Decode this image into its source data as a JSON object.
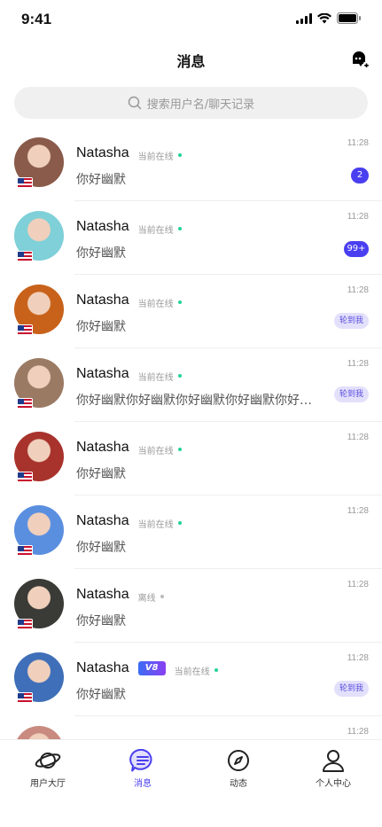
{
  "status_bar": {
    "time": "9:41"
  },
  "header": {
    "title": "消息",
    "action_icon": "chat-plus-icon"
  },
  "search": {
    "placeholder": "搜索用户名/聊天记录"
  },
  "conversations": [
    {
      "name": "Natasha",
      "status": "当前在线",
      "status_color": "#22d39b",
      "message": "你好幽默",
      "time": "11:28",
      "badge": "2",
      "tag": "",
      "vip": "",
      "avatar_color": "#8a5a4a",
      "flag": "us-flag-icon"
    },
    {
      "name": "Natasha",
      "status": "当前在线",
      "status_color": "#22d39b",
      "message": "你好幽默",
      "time": "11:28",
      "badge": "99+",
      "tag": "",
      "vip": "",
      "avatar_color": "#7fd0d8",
      "flag": "us-flag-icon"
    },
    {
      "name": "Natasha",
      "status": "当前在线",
      "status_color": "#22d39b",
      "message": "你好幽默",
      "time": "11:28",
      "badge": "",
      "tag": "轮到我",
      "vip": "",
      "avatar_color": "#c8621a",
      "flag": "us-flag-icon"
    },
    {
      "name": "Natasha",
      "status": "当前在线",
      "status_color": "#22d39b",
      "message": "你好幽默你好幽默你好幽默你好幽默你好幽默你好幽默",
      "time": "11:28",
      "badge": "",
      "tag": "轮到我",
      "vip": "",
      "avatar_color": "#9b7a64",
      "flag": "us-flag-icon"
    },
    {
      "name": "Natasha",
      "status": "当前在线",
      "status_color": "#22d39b",
      "message": "你好幽默",
      "time": "11:28",
      "badge": "",
      "tag": "",
      "vip": "",
      "avatar_color": "#a8332c",
      "flag": "us-flag-icon"
    },
    {
      "name": "Natasha",
      "status": "当前在线",
      "status_color": "#22d39b",
      "message": "你好幽默",
      "time": "11:28",
      "badge": "",
      "tag": "",
      "vip": "",
      "avatar_color": "#5a8fe0",
      "flag": "us-flag-icon"
    },
    {
      "name": "Natasha",
      "status": "离线",
      "status_color": "#bbbbbb",
      "message": "你好幽默",
      "time": "11:28",
      "badge": "",
      "tag": "",
      "vip": "",
      "avatar_color": "#3a3a36",
      "flag": "us-flag-icon"
    },
    {
      "name": "Natasha",
      "status": "当前在线",
      "status_color": "#22d39b",
      "message": "你好幽默",
      "time": "11:28",
      "badge": "",
      "tag": "轮到我",
      "vip": "V8",
      "avatar_color": "#3f6fb8",
      "flag": "us-flag-icon"
    },
    {
      "name": "",
      "status": "",
      "status_color": "#22d39b",
      "message": "",
      "time": "11:28",
      "badge": "",
      "tag": "",
      "vip": "",
      "avatar_color": "#c98a80",
      "flag": ""
    }
  ],
  "tabs": [
    {
      "label": "用户大厅",
      "icon": "planet-icon",
      "active": false
    },
    {
      "label": "消息",
      "icon": "message-icon",
      "active": true
    },
    {
      "label": "动态",
      "icon": "compass-icon",
      "active": false
    },
    {
      "label": "个人中心",
      "icon": "person-icon",
      "active": false
    }
  ],
  "colors": {
    "accent": "#4a3ff0",
    "online": "#22d39b",
    "offline": "#bbbbbb",
    "tag_bg": "#e3e0fb"
  }
}
